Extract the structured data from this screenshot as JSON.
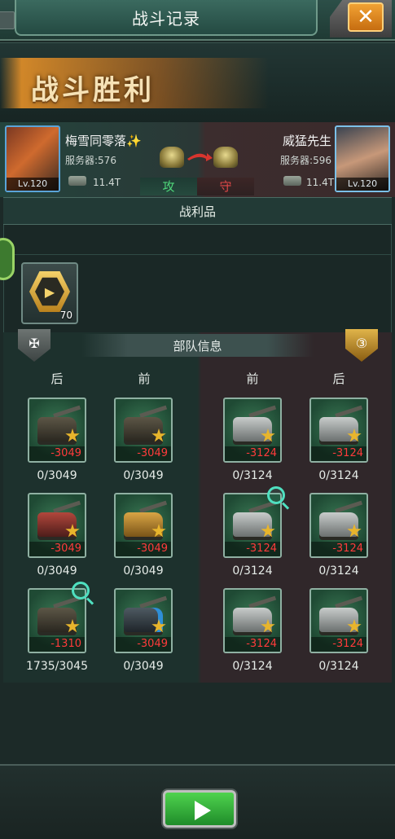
{
  "header": {
    "title": "战斗记录",
    "close_icon": "close-icon"
  },
  "result": {
    "text": "战斗胜利"
  },
  "attacker": {
    "name": "梅雪同零落✨",
    "server": "服务器:576",
    "level": "Lv.120",
    "power": "11.4T",
    "role": "攻"
  },
  "defender": {
    "name": "威猛先生",
    "server": "服务器:596",
    "level": "Lv.120",
    "power": "11.4T",
    "role": "守"
  },
  "loot": {
    "title": "战利品",
    "items": [
      {
        "icon": "gold-hex-badge-icon",
        "count": "70"
      }
    ]
  },
  "troops": {
    "title": "部队信息",
    "defender_badge": "③",
    "left_columns": [
      "后",
      "前"
    ],
    "right_columns": [
      "前",
      "后"
    ],
    "left_units": [
      {
        "loss": "-3049",
        "hp": "0/3049"
      },
      {
        "loss": "-3049",
        "hp": "0/3049"
      },
      {
        "loss": "-3049",
        "hp": "0/3049"
      },
      {
        "loss": "-3049",
        "hp": "0/3049"
      },
      {
        "loss": "-1310",
        "hp": "1735/3045"
      },
      {
        "loss": "-3049",
        "hp": "0/3049"
      }
    ],
    "right_units": [
      {
        "loss": "-3124",
        "hp": "0/3124"
      },
      {
        "loss": "-3124",
        "hp": "0/3124"
      },
      {
        "loss": "-3124",
        "hp": "0/3124"
      },
      {
        "loss": "-3124",
        "hp": "0/3124"
      },
      {
        "loss": "-3124",
        "hp": "0/3124"
      },
      {
        "loss": "-3124",
        "hp": "0/3124"
      }
    ]
  },
  "colors": {
    "loss_red": "#ff3b3b",
    "attack_green": "#4fd67a",
    "defend_red": "#e04848",
    "accent_orange": "#f2a234"
  }
}
